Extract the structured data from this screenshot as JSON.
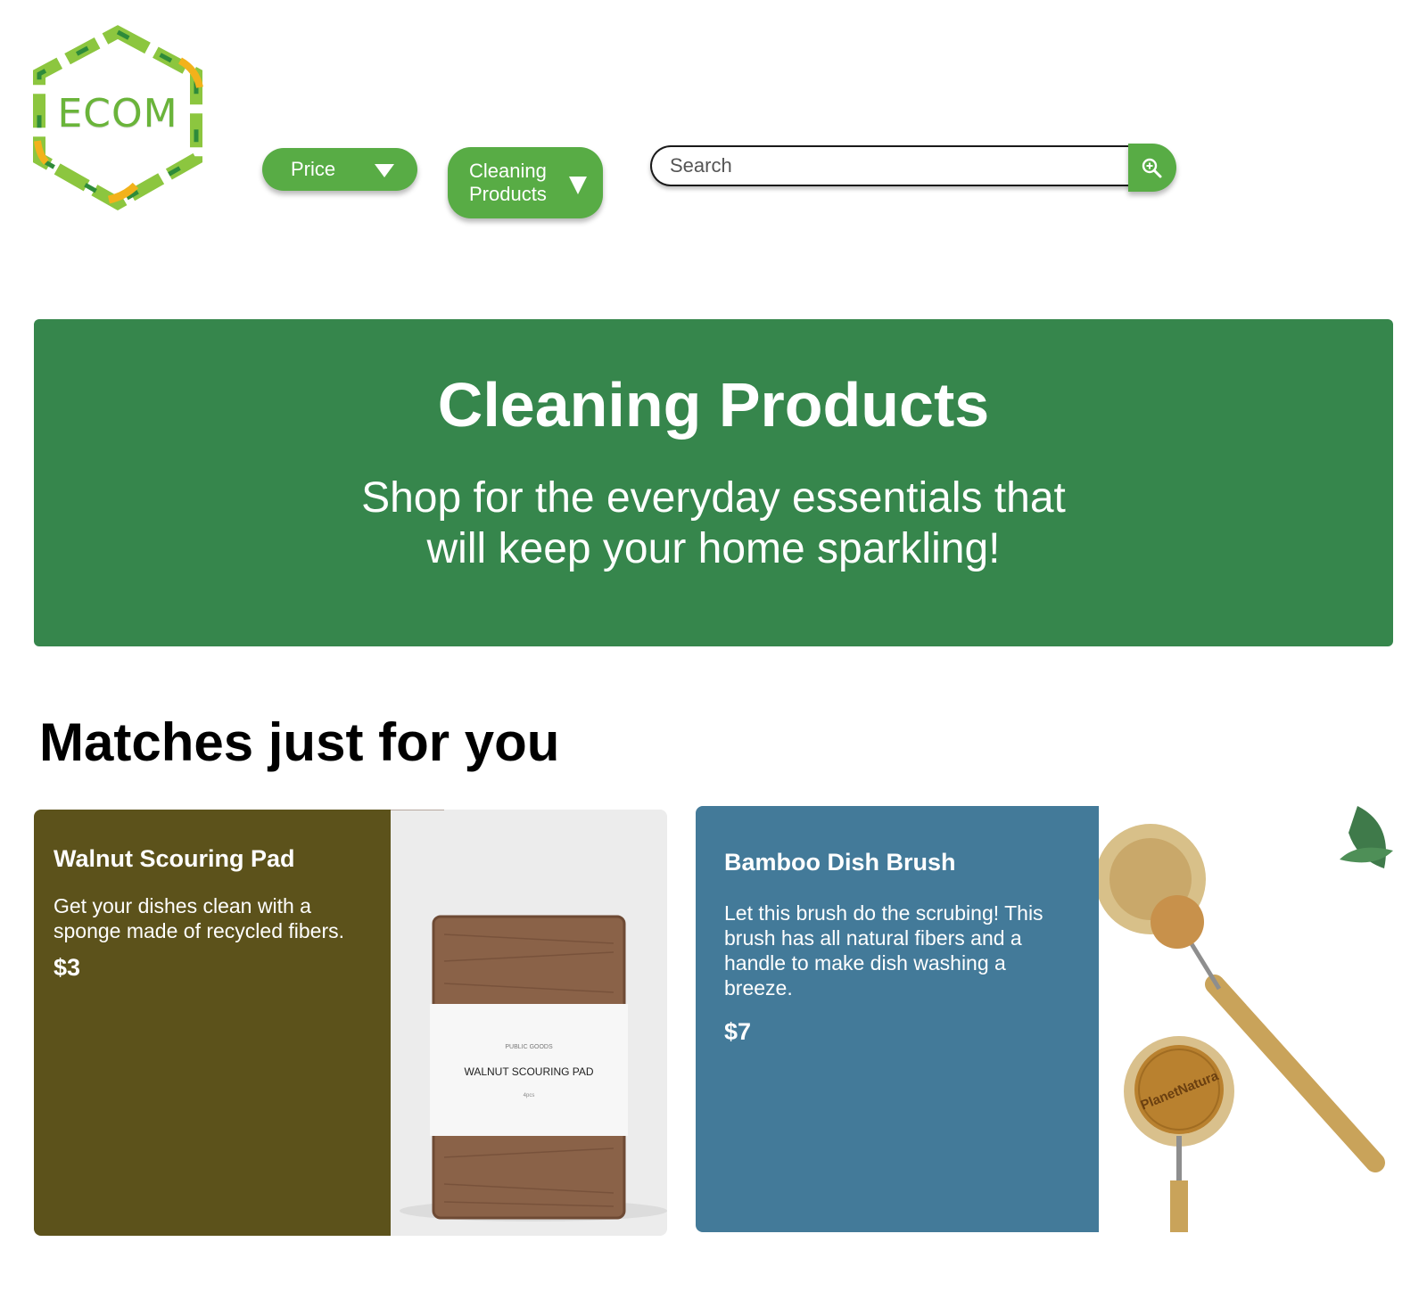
{
  "brand": {
    "logo_text": "ECOM"
  },
  "filters": {
    "price_label": "Price",
    "category_label": "Cleaning Products"
  },
  "search": {
    "placeholder": "Search"
  },
  "hero": {
    "title": "Cleaning Products",
    "subtitle": "Shop for the everyday essentials that will keep your home sparkling!"
  },
  "matches": {
    "title": "Matches just for you",
    "products": [
      {
        "name": "Walnut Scouring Pad",
        "description": "Get your dishes clean with a sponge made of recycled fibers.",
        "price": "$3",
        "package_label": "WALNUT SCOURING PAD"
      },
      {
        "name": "Bamboo Dish Brush",
        "description": "Let this brush do the scrubing! This brush has all natural fibers and a handle to make dish washing a breeze.",
        "price": "$7",
        "stamp_label": "PlanetNatura"
      }
    ]
  },
  "colors": {
    "accent_green": "#58ac45",
    "hero_green": "#36864c",
    "walnut_card": "#5c521b",
    "bamboo_card": "#437a99"
  },
  "icons": {
    "search": "zoom-in-icon",
    "dropdown": "caret-down-icon"
  }
}
